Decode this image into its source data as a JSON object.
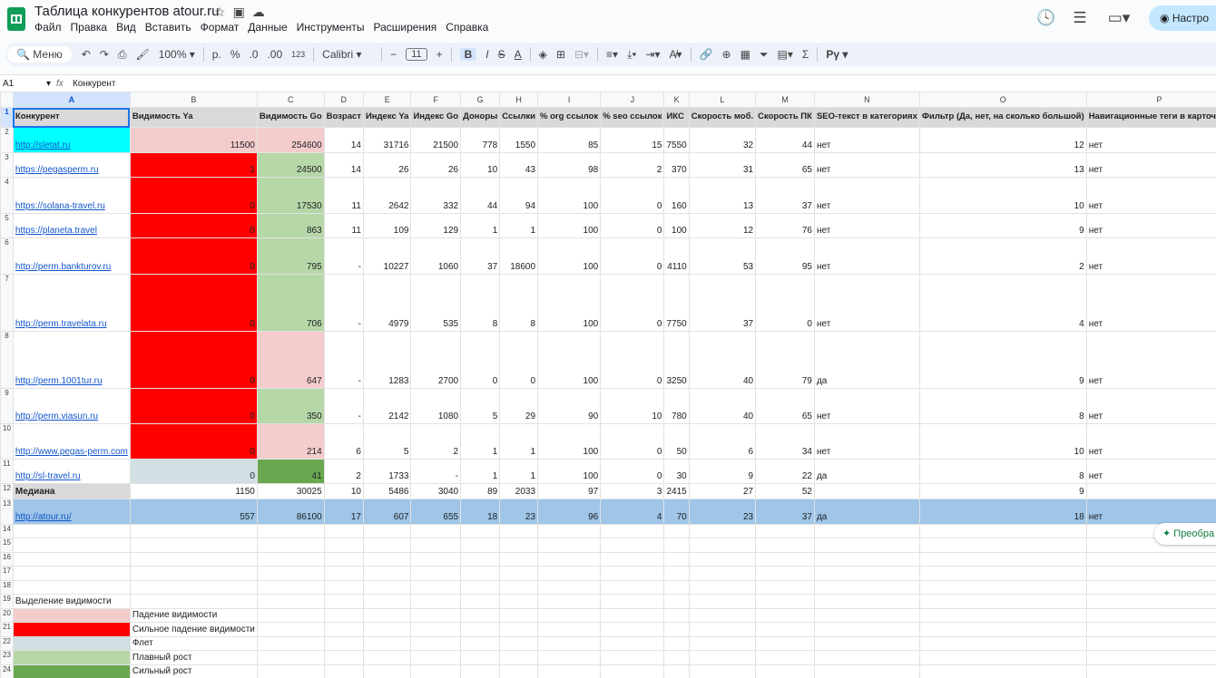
{
  "app": {
    "title": "Таблица конкурентов atour.ru",
    "menu": [
      "Файл",
      "Правка",
      "Вид",
      "Вставить",
      "Формат",
      "Данные",
      "Инструменты",
      "Расширения",
      "Справка"
    ],
    "share_label": "Настро",
    "convert_label": "Преобра"
  },
  "toolbar": {
    "search_label": "Меню",
    "zoom": "100%",
    "currency": "р.",
    "percent": "%",
    "dec_less": ".0",
    "dec_more": ".00",
    "number_format": "123",
    "font": "Calibri",
    "font_size": "11",
    "bold": "B",
    "italic": "I",
    "strike": "S",
    "text_color": "A",
    "sigma": "Σ",
    "ext": "Pγ"
  },
  "formula_bar": {
    "cell": "A1",
    "fx": "fx",
    "value": "Конкурент"
  },
  "columns": [
    "A",
    "B",
    "C",
    "D",
    "E",
    "F",
    "G",
    "H",
    "I",
    "J",
    "K",
    "L",
    "M",
    "N",
    "O",
    "P"
  ],
  "rows": [
    {
      "n": "1",
      "h": 22,
      "cells": [
        "Конкурент",
        "Видимость Ya",
        "Видимость Go",
        "Возраст",
        "Индекс Ya",
        "Индекс Go",
        "Доноры",
        "Ссылки",
        "% org ссылок",
        "% seo ссылок",
        "ИКС",
        "Скорость моб.",
        "Скорость ПК",
        "SEO-текст в категориях",
        "Фильтр (Да, нет, на сколько большой)",
        "Навигационные теги в карточках"
      ]
    },
    {
      "n": "2",
      "h": 28,
      "cells": [
        "http://sletat.ru",
        "11500",
        "254600",
        "14",
        "31716",
        "21500",
        "778",
        "1550",
        "85",
        "15",
        "7550",
        "32",
        "44",
        "нет",
        "12",
        "нет"
      ]
    },
    {
      "n": "3",
      "h": 27,
      "cells": [
        "https://pegasperm.ru",
        "1",
        "24500",
        "14",
        "26",
        "26",
        "10",
        "43",
        "98",
        "2",
        "370",
        "31",
        "65",
        "нет",
        "13",
        "нет"
      ]
    },
    {
      "n": "4",
      "h": 40,
      "cells": [
        "https://solana-travel.ru",
        "0",
        "17530",
        "11",
        "2642",
        "332",
        "44",
        "94",
        "100",
        "0",
        "160",
        "13",
        "37",
        "нет",
        "10",
        "нет"
      ]
    },
    {
      "n": "5",
      "h": 27,
      "cells": [
        "https://planeta.travel",
        "0",
        "863",
        "11",
        "109",
        "129",
        "1",
        "1",
        "100",
        "0",
        "100",
        "12",
        "76",
        "нет",
        "9",
        "нет"
      ]
    },
    {
      "n": "6",
      "h": 40,
      "cells": [
        "http://perm.bankturov.ru",
        "0",
        "795",
        "-",
        "10227",
        "1060",
        "37",
        "18600",
        "100",
        "0",
        "4110",
        "53",
        "95",
        "нет",
        "2",
        "нет"
      ]
    },
    {
      "n": "7",
      "h": 63,
      "cells": [
        "http://perm.travelata.ru",
        "0",
        "706",
        "-",
        "4979",
        "535",
        "8",
        "8",
        "100",
        "0",
        "7750",
        "37",
        "0",
        "нет",
        "4",
        "нет"
      ]
    },
    {
      "n": "8",
      "h": 63,
      "cells": [
        "http://perm.1001tur.ru",
        "0",
        "647",
        "-",
        "1283",
        "2700",
        "0",
        "0",
        "100",
        "0",
        "3250",
        "40",
        "79",
        "да",
        "9",
        "нет"
      ]
    },
    {
      "n": "9",
      "h": 39,
      "cells": [
        "http://perm.viasun.ru",
        "0",
        "350",
        "-",
        "2142",
        "1080",
        "5",
        "29",
        "90",
        "10",
        "780",
        "40",
        "65",
        "нет",
        "8",
        "нет"
      ]
    },
    {
      "n": "10",
      "h": 39,
      "cells": [
        "http://www.pegas-perm.com",
        "0",
        "214",
        "6",
        "5",
        "2",
        "1",
        "1",
        "100",
        "0",
        "50",
        "6",
        "34",
        "нет",
        "10",
        "нет"
      ]
    },
    {
      "n": "11",
      "h": 27,
      "cells": [
        "http://sl-travel.ru",
        "0",
        "41",
        "2",
        "1733",
        "-",
        "1",
        "1",
        "100",
        "0",
        "30",
        "9",
        "22",
        "да",
        "8",
        "нет"
      ]
    },
    {
      "n": "12",
      "h": 17,
      "cells": [
        "Медиана",
        "1150",
        "30025",
        "10",
        "5486",
        "3040",
        "89",
        "2033",
        "97",
        "3",
        "2415",
        "27",
        "52",
        "",
        "9",
        ""
      ]
    },
    {
      "n": "13",
      "h": 28,
      "cells": [
        "http://atour.ru/",
        "557",
        "86100",
        "17",
        "607",
        "655",
        "18",
        "23",
        "96",
        "4",
        "70",
        "23",
        "37",
        "да",
        "18",
        "нет"
      ]
    },
    {
      "n": "14",
      "h": 15,
      "cells": [
        "",
        "",
        "",
        "",
        "",
        "",
        "",
        "",
        "",
        "",
        "",
        "",
        "",
        "",
        "",
        ""
      ]
    },
    {
      "n": "15",
      "h": 16,
      "cells": [
        "",
        "",
        "",
        "",
        "",
        "",
        "",
        "",
        "",
        "",
        "",
        "",
        "",
        "",
        "",
        ""
      ]
    },
    {
      "n": "16",
      "h": 15,
      "cells": [
        "",
        "",
        "",
        "",
        "",
        "",
        "",
        "",
        "",
        "",
        "",
        "",
        "",
        "",
        "",
        ""
      ]
    },
    {
      "n": "17",
      "h": 16,
      "cells": [
        "",
        "",
        "",
        "",
        "",
        "",
        "",
        "",
        "",
        "",
        "",
        "",
        "",
        "",
        "",
        ""
      ]
    },
    {
      "n": "18",
      "h": 15,
      "cells": [
        "",
        "",
        "",
        "",
        "",
        "",
        "",
        "",
        "",
        "",
        "",
        "",
        "",
        "",
        "",
        ""
      ]
    },
    {
      "n": "19",
      "h": 16,
      "cells": [
        "Выделение видимости",
        "",
        "",
        "",
        "",
        "",
        "",
        "",
        "",
        "",
        "",
        "",
        "",
        "",
        "",
        ""
      ]
    },
    {
      "n": "20",
      "h": 15,
      "cells": [
        "",
        "Падение видимости",
        "",
        "",
        "",
        "",
        "",
        "",
        "",
        "",
        "",
        "",
        "",
        "",
        "",
        ""
      ]
    },
    {
      "n": "21",
      "h": 16,
      "cells": [
        "",
        "Сильное падение видимости",
        "",
        "",
        "",
        "",
        "",
        "",
        "",
        "",
        "",
        "",
        "",
        "",
        "",
        ""
      ]
    },
    {
      "n": "22",
      "h": 15,
      "cells": [
        "",
        "Флет",
        "",
        "",
        "",
        "",
        "",
        "",
        "",
        "",
        "",
        "",
        "",
        "",
        "",
        ""
      ]
    },
    {
      "n": "23",
      "h": 16,
      "cells": [
        "",
        "Плавный рост",
        "",
        "",
        "",
        "",
        "",
        "",
        "",
        "",
        "",
        "",
        "",
        "",
        "",
        ""
      ]
    },
    {
      "n": "24",
      "h": 15,
      "cells": [
        "",
        "Сильный рост",
        "",
        "",
        "",
        "",
        "",
        "",
        "",
        "",
        "",
        "",
        "",
        "",
        "",
        ""
      ]
    }
  ],
  "colors": {
    "strong_drop": "#ff0000",
    "drop": "#f4cccc",
    "flat": "#d0e0e3",
    "smooth_growth": "#b6d7a8",
    "strong_growth": "#6aa84f",
    "own_site": "#9fc5e8",
    "highlight": "#00ffff"
  }
}
